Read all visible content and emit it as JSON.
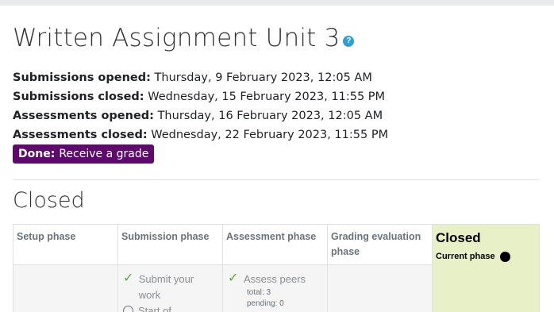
{
  "assignment": {
    "title": "Written Assignment Unit 3",
    "help_icon": "question-circle-icon"
  },
  "dates": [
    {
      "label": "Submissions opened:",
      "value": "Thursday, 9 February 2023, 12:05 AM"
    },
    {
      "label": "Submissions closed:",
      "value": "Wednesday, 15 February 2023, 11:55 PM"
    },
    {
      "label": "Assessments opened:",
      "value": "Thursday, 16 February 2023, 12:05 AM"
    },
    {
      "label": "Assessments closed:",
      "value": "Wednesday, 22 February 2023, 11:55 PM"
    }
  ],
  "status_badge": {
    "label": "Done:",
    "text": "Receive a grade",
    "color": "#5e0a6d"
  },
  "section": {
    "title": "Closed"
  },
  "phases": [
    {
      "name": "Setup phase"
    },
    {
      "name": "Submission phase",
      "task": "Submit your work",
      "task_icon": "check-icon",
      "next_icon": "clock-icon",
      "next_text": "Start of"
    },
    {
      "name": "Assessment phase",
      "task": "Assess peers",
      "task_icon": "check-icon",
      "details": [
        "total: 3",
        "pending: 0"
      ]
    },
    {
      "name": "Grading evaluation phase"
    },
    {
      "name": "Closed",
      "current_label": "Current phase",
      "current_icon": "filled-circle-icon",
      "highlight_color": "#e8f0c8"
    }
  ]
}
